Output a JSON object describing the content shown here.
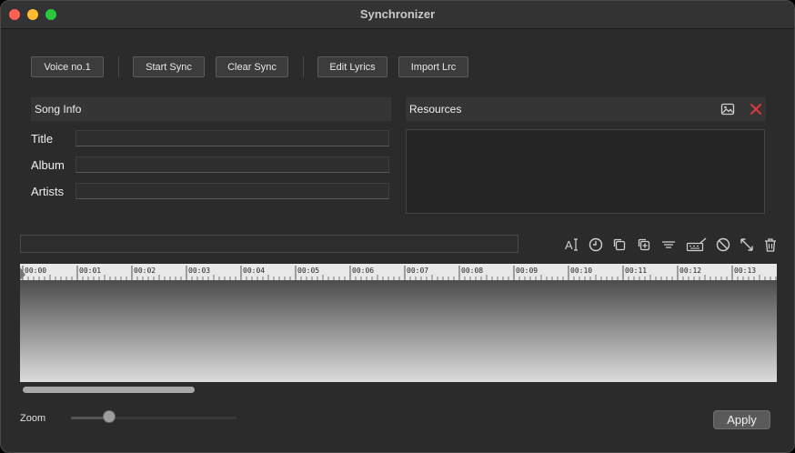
{
  "window": {
    "title": "Synchronizer"
  },
  "toolbar": {
    "voice_label": "Voice no.1",
    "start_sync_label": "Start Sync",
    "clear_sync_label": "Clear Sync",
    "edit_lyrics_label": "Edit Lyrics",
    "import_lrc_label": "Import Lrc"
  },
  "song_info": {
    "header": "Song Info",
    "title_label": "Title",
    "title_value": "",
    "album_label": "Album",
    "album_value": "",
    "artists_label": "Artists",
    "artists_value": ""
  },
  "resources": {
    "header": "Resources",
    "icons": [
      "image-icon",
      "close-icon"
    ]
  },
  "lyric_editor": {
    "current_line": "",
    "tools": [
      "text-size-icon",
      "clock-icon",
      "copy-icon",
      "add-copy-icon",
      "align-icon",
      "keyboard-edit-icon",
      "block-icon",
      "expand-icon",
      "trash-icon"
    ]
  },
  "timeline": {
    "ticks": [
      "00:00",
      "00:01",
      "00:02",
      "00:03",
      "00:04",
      "00:05",
      "00:06",
      "00:07",
      "00:08",
      "00:09",
      "00:10",
      "00:11",
      "00:12",
      "00:13"
    ]
  },
  "zoom": {
    "label": "Zoom",
    "value": 0.23
  },
  "footer": {
    "apply_label": "Apply"
  },
  "colors": {
    "delete_accent": "#e0383e",
    "background": "#2b2b2b"
  }
}
